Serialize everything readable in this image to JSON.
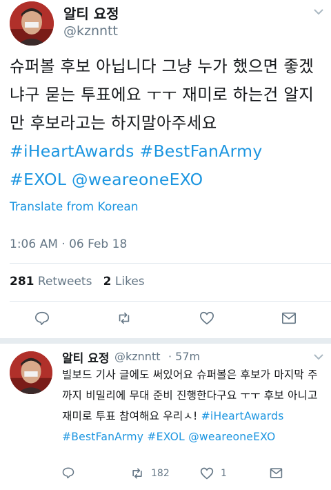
{
  "main_tweet": {
    "display_name": "알티 요정",
    "handle": "@kznntt",
    "text": "슈퍼볼 후보 아닙니다 그냥 누가 했으면 좋겠냐구 묻는 투표에요 ㅜㅜ 재미로 하는건 알지만 후보라고는 하지말아주세요 ",
    "hashtags": [
      "#iHeartAwards",
      "#BestFanArmy",
      "#EXOL"
    ],
    "mention": "@weareoneEXO",
    "translate_label": "Translate from Korean",
    "timestamp": "1:06 AM · 06 Feb 18",
    "retweet_count": "281",
    "retweet_label": "Retweets",
    "like_count": "2",
    "like_label": "Likes"
  },
  "reply_tweet": {
    "display_name": "알티 요정",
    "handle": "@kznntt",
    "time_ago": "· 57m",
    "text": "빌보드 기사 글에도 써있어요 슈퍼볼은 후보가 마지막 주까지 비밀리에 무대 준비 진행한다구요 ㅜㅜ 후보 아니고 재미로 투표 참여해요 우리ㅅ! ",
    "hashtags": [
      "#iHeartAwards",
      "#BestFanArmy",
      "#EXOL"
    ],
    "mention": "@weareoneEXO",
    "retweet_count": "182",
    "like_count": "1"
  },
  "icons": {
    "reply": "reply-icon",
    "retweet": "retweet-icon",
    "like": "heart-icon",
    "dm": "envelope-icon",
    "menu": "chevron-down-icon"
  },
  "colors": {
    "link": "#1b95e0",
    "secondary_text": "#657786",
    "divider": "#e1e8ed"
  }
}
